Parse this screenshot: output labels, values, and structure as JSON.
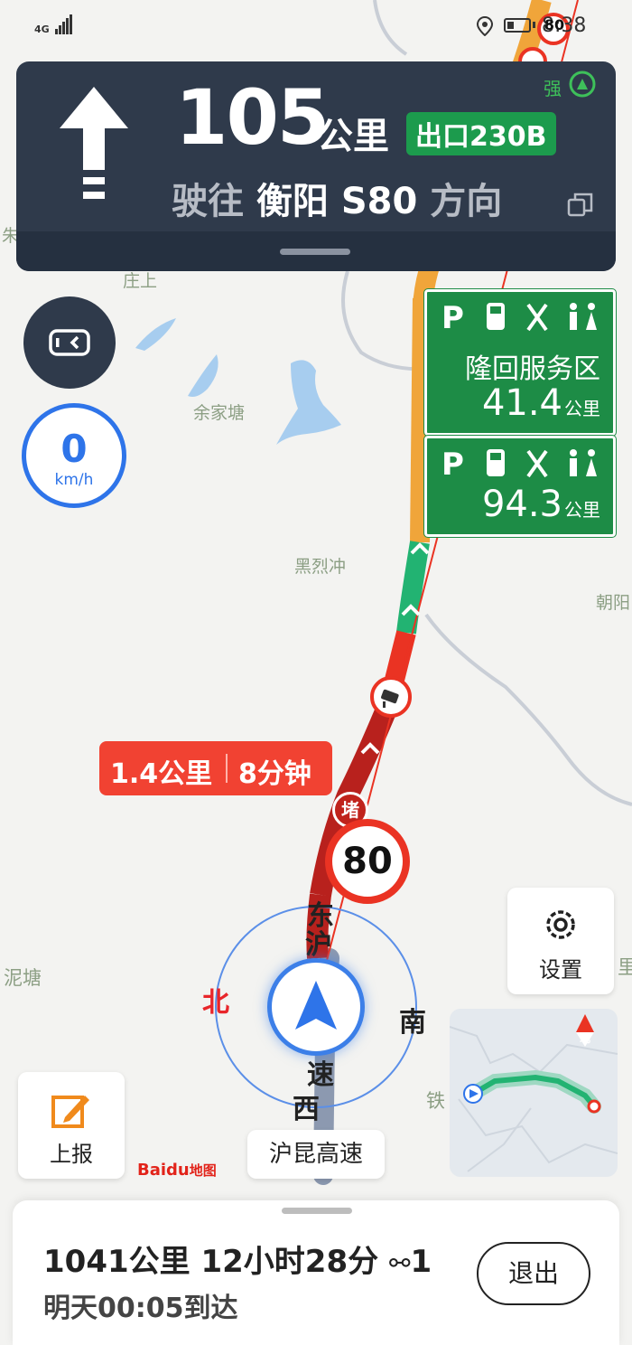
{
  "status_bar": {
    "network": "4G",
    "time": "8:38",
    "speed_limit_ahead": "80"
  },
  "guidance": {
    "distance_value": "105",
    "distance_unit": "公里",
    "exit_label": "出口230B",
    "gps_signal": "强",
    "toward_prefix": "驶往",
    "destination": "衡阳 S80",
    "toward_suffix": "方向"
  },
  "current_speed": {
    "value": "0",
    "unit": "km/h"
  },
  "service_areas": [
    {
      "name": "隆回服务区",
      "distance": "41.4",
      "unit": "公里"
    },
    {
      "distance": "94.3",
      "unit": "公里"
    }
  ],
  "traffic_bubble": {
    "distance": "1.4公里",
    "time": "8分钟"
  },
  "congestion_tag": "堵",
  "speed_limit": "80",
  "compass": {
    "north": "北",
    "south": "南",
    "west": "西"
  },
  "road_chars": {
    "dong": "东",
    "hu": "沪",
    "su": "速"
  },
  "buttons": {
    "settings": "设置",
    "report": "上报",
    "exit": "退出"
  },
  "current_road": "沪昆高速",
  "minimap": {
    "north": "北"
  },
  "logo": {
    "brand": "Baidu",
    "product": "地图"
  },
  "trip": {
    "distance": "1041公里",
    "duration": "12小时28分",
    "lights_count": "1",
    "arrival": "明天00:05到达"
  },
  "map_labels": [
    "朱",
    "庄上",
    "余家塘",
    "黑烈冲",
    "朝阳",
    "泥塘",
    "铁",
    "里"
  ]
}
